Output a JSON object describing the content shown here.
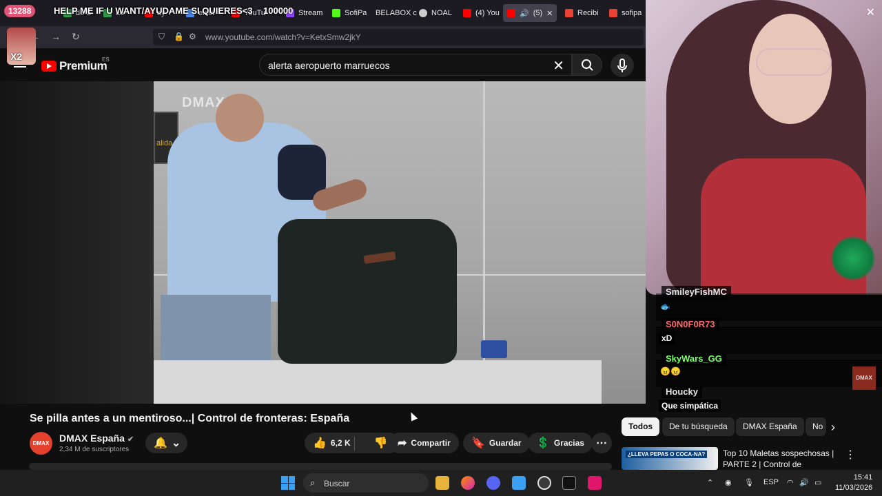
{
  "browser": {
    "tabs": [
      {
        "label": "de S",
        "color": "#2f9f4a"
      },
      {
        "label": "Lo",
        "color": "#2f9f4a"
      },
      {
        "label": "ay Y",
        "color": "#ff0000"
      },
      {
        "label": "elect",
        "color": "#4a8bf0"
      },
      {
        "label": "YouTu",
        "color": "#ff0000"
      },
      {
        "label": "Stream",
        "color": "#9146ff"
      },
      {
        "label": "SofiPa",
        "color": "#53fc18"
      },
      {
        "label": "BELABOX c",
        "color": "#ffffff"
      },
      {
        "label": "NOAL",
        "color": "#cccccc"
      },
      {
        "label": "(4) You",
        "color": "#ff0000"
      },
      {
        "label": "(5)",
        "color": "#ff0000",
        "active": true
      },
      {
        "label": "Recibi",
        "color": "#ea4335"
      },
      {
        "label": "sofipa",
        "color": "#ea4335"
      }
    ],
    "url": "www.youtube.com/watch?v=KetxSmw2jkY"
  },
  "youtube": {
    "logo": "Premium",
    "region": "ES",
    "search_value": "alerta aeropuerto marruecos",
    "video_watermark": "DMAX",
    "video_sign_text": "alida",
    "video": {
      "title": "Se pilla antes a un mentiroso...| Control de fronteras: España",
      "channel": "DMAX España",
      "channel_logo": "DMAX",
      "subscribers": "2,34 M de suscriptores",
      "likes": "6,2 K",
      "share": "Compartir",
      "save": "Guardar",
      "thanks": "Gracias"
    },
    "chips": [
      "Todos",
      "De tu búsqueda",
      "DMAX España",
      "No"
    ],
    "recommendation": {
      "title": "Top 10 Maletas sospechosas | PARTE 2 | Control de fronteras...",
      "thumb_text": "¿LLEVA PEPAS O COCA-NA?"
    }
  },
  "stream_overlay": {
    "viewers": "13288",
    "goal_text": "HELP ME IF U WANT/AYUDAME SI QUIERES<3",
    "goal_amount": "100000",
    "avatar_badge": "X2",
    "corner_logo": "DMAX"
  },
  "chat": [
    {
      "user": "SmileyFishMC",
      "user_color": "#e6e6e6",
      "message": ""
    },
    {
      "user": "S0N0F0R73",
      "user_color": "#ff6b6b",
      "message": "xD"
    },
    {
      "user": "SkyWars_GG",
      "user_color": "#7dff6b",
      "message": ""
    },
    {
      "user": "Houcky",
      "user_color": "#e6e6e6",
      "message": "Que simpática"
    }
  ],
  "taskbar": {
    "search_placeholder": "Buscar",
    "language": "ESP",
    "time": "15:41",
    "date": "11/03/2026",
    "apps": [
      "folder-icon",
      "firefox-icon",
      "discord-icon",
      "photos-icon",
      "obs-icon",
      "terminal-icon",
      "app-icon"
    ]
  }
}
